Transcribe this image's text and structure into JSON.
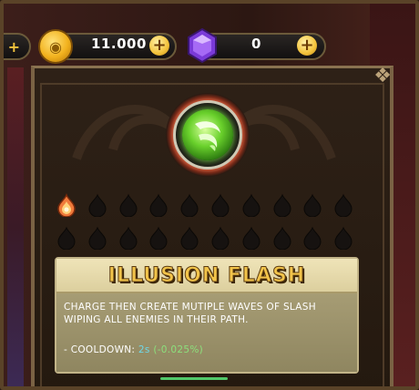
{
  "currency": {
    "coins": {
      "icon": "gold-coin-icon",
      "amount": "11.000",
      "add_label": "+"
    },
    "gems": {
      "icon": "purple-gem-icon",
      "amount": "0",
      "add_label": "+"
    },
    "left_pill_arrow": "+"
  },
  "skill": {
    "icon": "green-slash-icon",
    "name": "ILLUSION FLASH",
    "description": "CHARGE THEN CREATE MUTIPLE WAVES OF SLASH WIPING ALL ENEMIES IN THEIR PATH.",
    "cooldown_label": "- COOLDOWN: ",
    "cooldown_value": "2s",
    "cooldown_modifier": "(-0.025%)"
  },
  "upgrade_slots": {
    "total": 20,
    "filled": 1,
    "filled_icon": "flame-drop-icon",
    "empty_icon": "empty-drop-icon"
  },
  "colors": {
    "title_gold": "#f2c44a",
    "cooldown_value": "#6fd8e8",
    "cooldown_modifier": "#8ce07c",
    "skill_glow": "#7be04a"
  }
}
